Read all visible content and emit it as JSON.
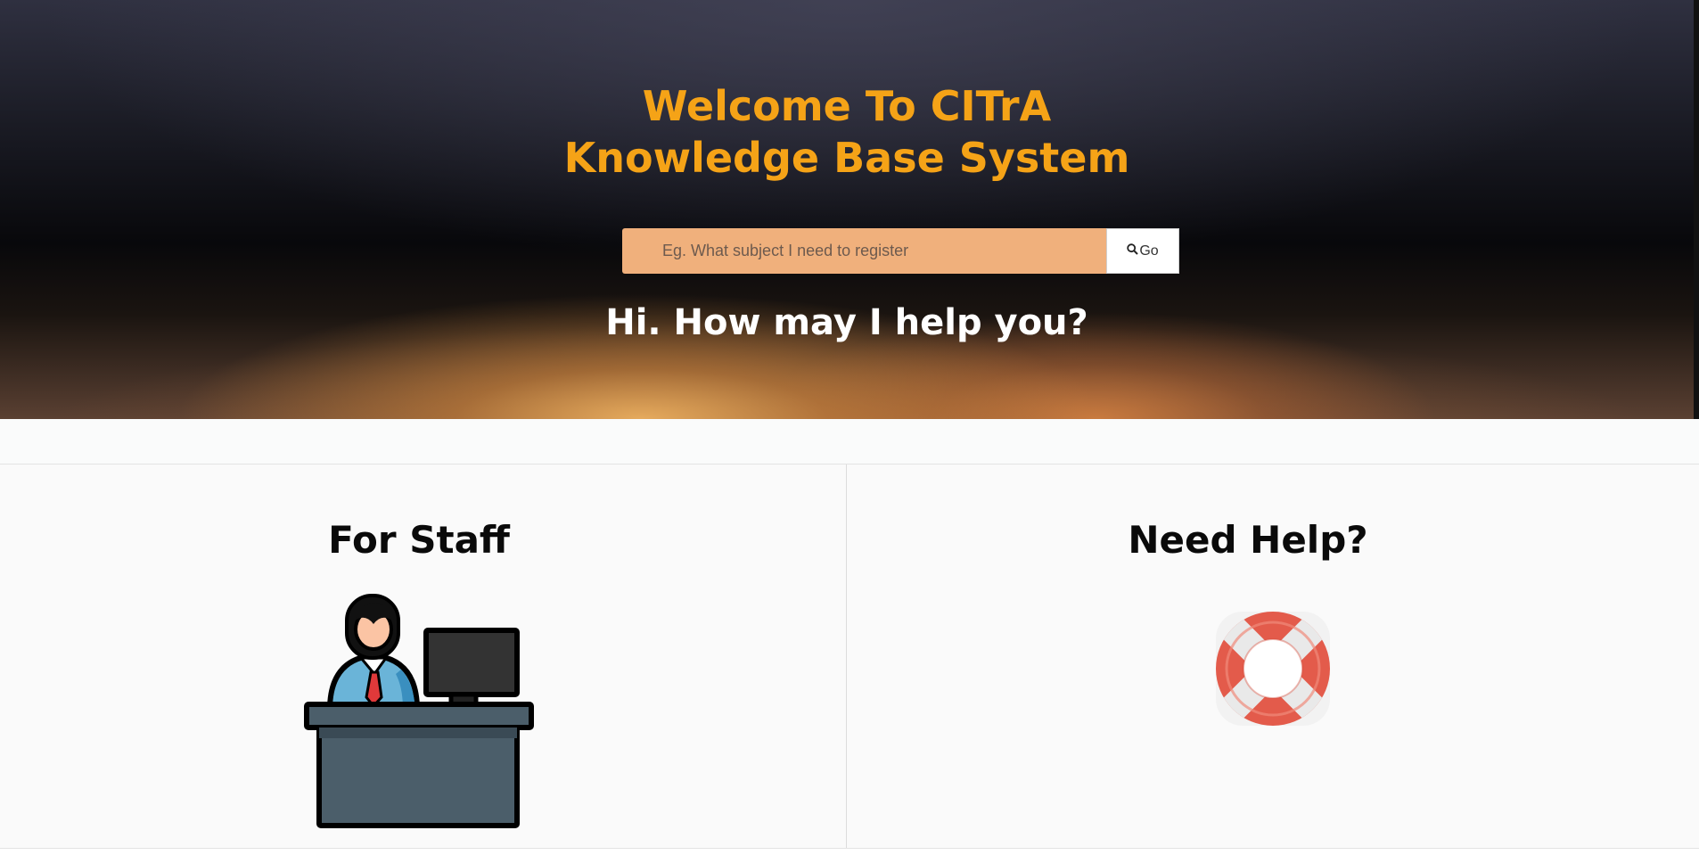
{
  "hero": {
    "title_line1": "Welcome To CITrA",
    "title_line2": "Knowledge Base System",
    "subtitle": "Hi. How may I help you?"
  },
  "search": {
    "placeholder": "Eg. What subject I need to register",
    "value": "",
    "button_label": "Go",
    "button_icon": "search-icon"
  },
  "cards": [
    {
      "title": "For Staff",
      "icon": "staff-desk-icon"
    },
    {
      "title": "Need Help?",
      "icon": "lifebuoy-icon"
    }
  ],
  "colors": {
    "title_orange": "#f5a317",
    "search_bg": "#f0b07c",
    "lifebuoy_red": "#e35b4b"
  }
}
